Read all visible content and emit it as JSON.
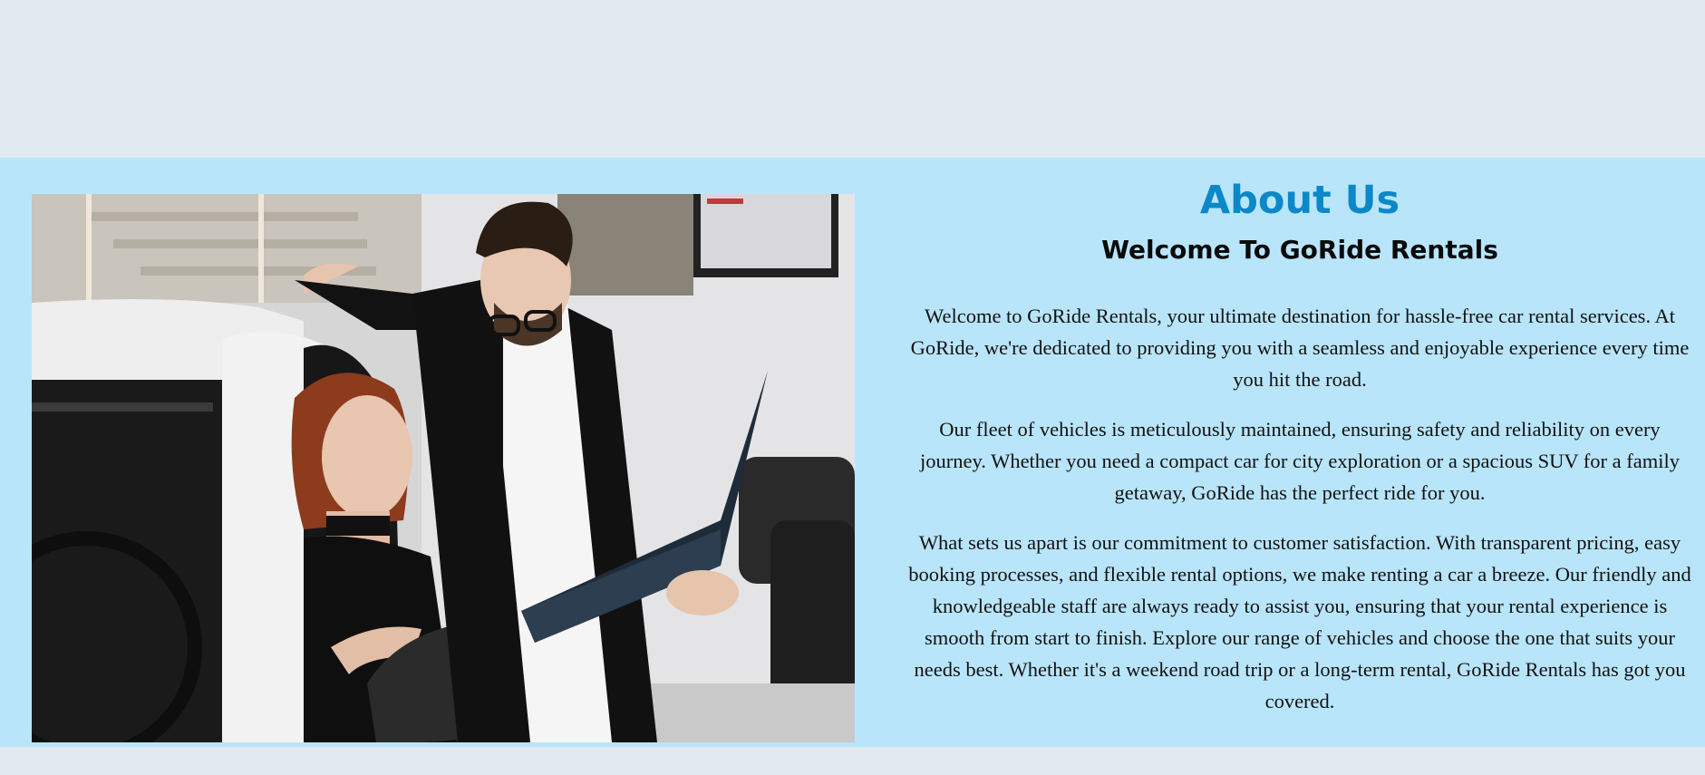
{
  "about": {
    "title": "About Us",
    "subtitle": "Welcome To GoRide Rentals",
    "paragraphs": [
      "Welcome to GoRide Rentals, your ultimate destination for hassle-free car rental services. At GoRide, we're dedicated to providing you with a seamless and enjoyable experience every time you hit the road.",
      "Our fleet of vehicles is meticulously maintained, ensuring safety and reliability on every journey. Whether you need a compact car for city exploration or a spacious SUV for a family getaway, GoRide has the perfect ride for you.",
      "What sets us apart is our commitment to customer satisfaction. With transparent pricing, easy booking processes, and flexible rental options, we make renting a car a breeze. Our friendly and knowledgeable staff are always ready to assist you, ensuring that your rental experience is smooth from start to finish. Explore our range of vehicles and choose the one that suits your needs best. Whether it's a weekend road trip or a long-term rental, GoRide Rentals has got you covered."
    ],
    "image": {
      "icon": "photo-car-dealership"
    }
  },
  "colors": {
    "page_background": "#e1e9f1",
    "section_background": "#b9e5fb",
    "title_color": "#0c88c8",
    "text_color": "#111111"
  }
}
